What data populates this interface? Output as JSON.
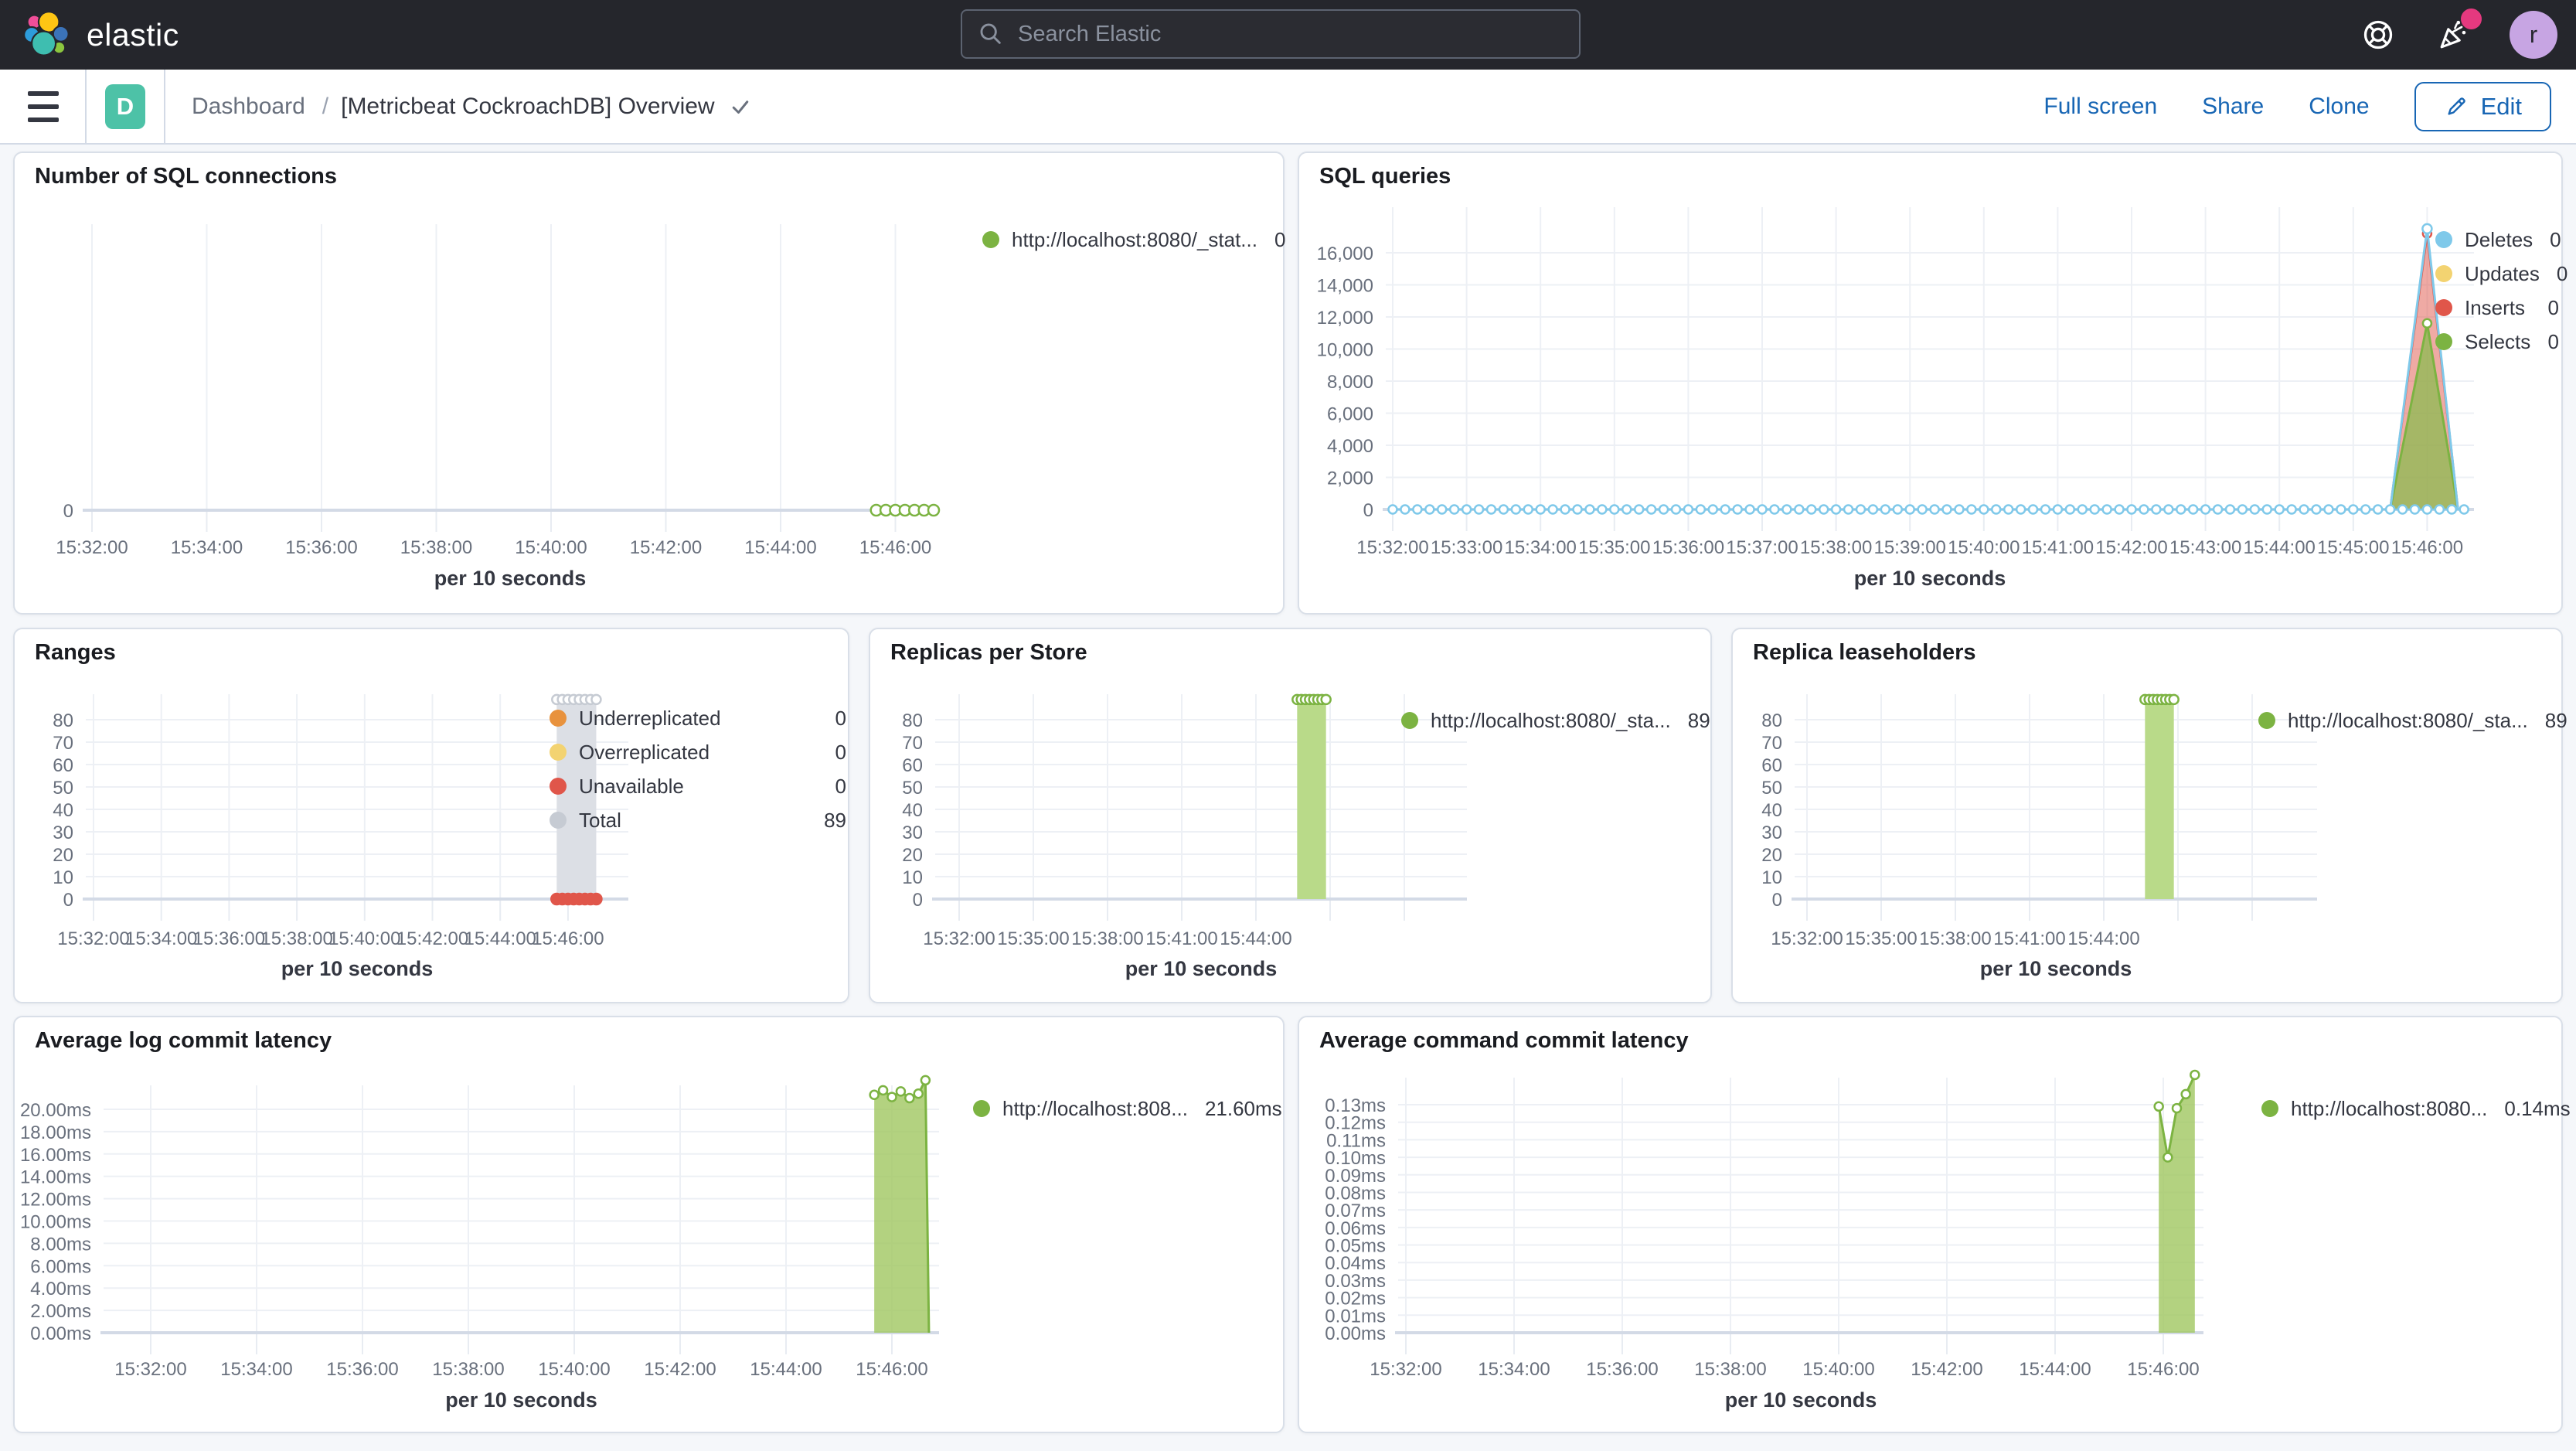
{
  "header": {
    "logo_text": "elastic",
    "search_placeholder": "Search Elastic",
    "avatar_letter": "r",
    "icons": [
      "search-icon",
      "life-buoy-icon",
      "party-popper-icon"
    ]
  },
  "toolbar": {
    "menu_icon": "hamburger-icon",
    "badge_letter": "D",
    "breadcrumb_root": "Dashboard",
    "separator": "/",
    "title": "[Metricbeat CockroachDB] Overview",
    "links": [
      "Full screen",
      "Share",
      "Clone"
    ],
    "edit_label": "Edit"
  },
  "colors": {
    "topbar_bg": "#25262C",
    "accent_blue": "#1866B4",
    "badge_teal": "#4DC2A7",
    "notification_pink": "#E5397F",
    "series_green": "#7CB342",
    "series_blue": "#7FC9EA",
    "series_red": "#E0564A",
    "series_yellow": "#F3D371",
    "series_orange": "#E8923D",
    "series_gray": "#C6CBD3"
  },
  "chart_data": [
    {
      "type": "line",
      "title": "Number of SQL connections",
      "xlabel": "per 10 seconds",
      "x_interval_s": 120,
      "x_ticks": [
        "15:32:00",
        "15:34:00",
        "15:36:00",
        "15:38:00",
        "15:40:00",
        "15:42:00",
        "15:44:00",
        "15:46:00"
      ],
      "y_ticks": [
        {
          "label": "0",
          "v": 0
        }
      ],
      "series": [
        {
          "name": "http://localhost:8080/_stat...",
          "style": "dots",
          "color": "#7CB342",
          "value": 0,
          "from": "15:45:40",
          "to": "15:46:40",
          "interval_s": 10,
          "connect": true
        }
      ],
      "legend": [
        {
          "label": "http://localhost:8080/_stat...",
          "value": "0",
          "color": "#7CB342"
        }
      ]
    },
    {
      "type": "area",
      "title": "SQL queries",
      "xlabel": "per 10 seconds",
      "x_interval_s": 60,
      "x_ticks": [
        "15:32:00",
        "15:33:00",
        "15:34:00",
        "15:35:00",
        "15:36:00",
        "15:37:00",
        "15:38:00",
        "15:39:00",
        "15:40:00",
        "15:41:00",
        "15:42:00",
        "15:43:00",
        "15:44:00",
        "15:45:00",
        "15:46:00"
      ],
      "y_ticks": [
        {
          "label": "16,000",
          "v": 16000
        },
        {
          "label": "14,000",
          "v": 14000
        },
        {
          "label": "12,000",
          "v": 12000
        },
        {
          "label": "10,000",
          "v": 10000
        },
        {
          "label": "8,000",
          "v": 8000
        },
        {
          "label": "6,000",
          "v": 6000
        },
        {
          "label": "4,000",
          "v": 4000
        },
        {
          "label": "2,000",
          "v": 2000
        },
        {
          "label": "0",
          "v": 0
        }
      ],
      "series": [
        {
          "name": "Inserts",
          "style": "area",
          "color": "#E0564A",
          "fill": "rgba(224,86,74,0.5)",
          "points": [
            [
              "15:45:30",
              0
            ],
            [
              "15:46:00",
              17200
            ],
            [
              "15:46:25",
              0
            ]
          ]
        },
        {
          "name": "Selects",
          "style": "area",
          "color": "#7CB342",
          "fill": "rgba(140,187,81,0.75)",
          "points": [
            [
              "15:45:30",
              0
            ],
            [
              "15:46:00",
              11600
            ],
            [
              "15:46:25",
              0
            ]
          ]
        },
        {
          "name": "Deletes",
          "style": "zline",
          "color": "#7FC9EA",
          "value": 0,
          "from": "15:32:00",
          "to": "15:46:30",
          "interval_s": 10,
          "spike": [
            [
              "15:45:30",
              0
            ],
            [
              "15:46:00",
              17500
            ],
            [
              "15:46:25",
              0
            ]
          ]
        },
        {
          "name": "Updates",
          "style": "hidden",
          "color": "#F3D371",
          "value": 0
        }
      ],
      "legend": [
        {
          "label": "Deletes",
          "value": "0",
          "color": "#7FC9EA"
        },
        {
          "label": "Updates",
          "value": "0",
          "color": "#F3D371"
        },
        {
          "label": "Inserts",
          "value": "0",
          "color": "#E0564A"
        },
        {
          "label": "Selects",
          "value": "0",
          "color": "#7CB342"
        }
      ]
    },
    {
      "type": "bar",
      "title": "Ranges",
      "xlabel": "per 10 seconds",
      "x_interval_s": 120,
      "x_ticks": [
        "15:32:00",
        "15:34:00",
        "15:36:00",
        "15:38:00",
        "15:40:00",
        "15:42:00",
        "15:44:00",
        "15:46:00"
      ],
      "y_ticks": [
        {
          "label": "80",
          "v": 80
        },
        {
          "label": "70",
          "v": 70
        },
        {
          "label": "60",
          "v": 60
        },
        {
          "label": "50",
          "v": 50
        },
        {
          "label": "40",
          "v": 40
        },
        {
          "label": "30",
          "v": 30
        },
        {
          "label": "20",
          "v": 20
        },
        {
          "label": "10",
          "v": 10
        },
        {
          "label": "0",
          "v": 0
        }
      ],
      "series": [
        {
          "name": "Total",
          "style": "bar",
          "color": "#DCDFE5",
          "marker_color": "#C6CBD3",
          "value": 89,
          "from": "15:45:40",
          "to": "15:46:50",
          "marker_interval_s": 10
        },
        {
          "name": "Unavailable",
          "style": "dots",
          "color": "#E0564A",
          "filled": true,
          "value": 0,
          "from": "15:45:40",
          "to": "15:46:50",
          "interval_s": 10
        }
      ],
      "legend": [
        {
          "label": "Underreplicated",
          "value": "0",
          "color": "#E8923D"
        },
        {
          "label": "Overreplicated",
          "value": "0",
          "color": "#F3D371"
        },
        {
          "label": "Unavailable",
          "value": "0",
          "color": "#E0564A"
        },
        {
          "label": "Total",
          "value": "89",
          "color": "#C6CBD3"
        }
      ]
    },
    {
      "type": "bar",
      "title": "Replicas per Store",
      "xlabel": "per 10 seconds",
      "x_interval_s": 180,
      "x_ticks": [
        "15:32:00",
        "15:35:00",
        "15:38:00",
        "15:41:00",
        "15:44:00"
      ],
      "y_ticks": [
        {
          "label": "80",
          "v": 80
        },
        {
          "label": "70",
          "v": 70
        },
        {
          "label": "60",
          "v": 60
        },
        {
          "label": "50",
          "v": 50
        },
        {
          "label": "40",
          "v": 40
        },
        {
          "label": "30",
          "v": 30
        },
        {
          "label": "20",
          "v": 20
        },
        {
          "label": "10",
          "v": 10
        },
        {
          "label": "0",
          "v": 0
        }
      ],
      "series": [
        {
          "name": "http://localhost:8080/_sta...",
          "style": "bar",
          "color": "#B9DA89",
          "marker_color": "#7CB342",
          "value": 89,
          "from": "15:45:40",
          "to": "15:46:50",
          "marker_interval_s": 10
        }
      ],
      "legend": [
        {
          "label": "http://localhost:8080/_sta...",
          "value": "89",
          "color": "#7CB342"
        }
      ]
    },
    {
      "type": "bar",
      "title": "Replica leaseholders",
      "xlabel": "per 10 seconds",
      "x_interval_s": 180,
      "x_ticks": [
        "15:32:00",
        "15:35:00",
        "15:38:00",
        "15:41:00",
        "15:44:00"
      ],
      "y_ticks": [
        {
          "label": "80",
          "v": 80
        },
        {
          "label": "70",
          "v": 70
        },
        {
          "label": "60",
          "v": 60
        },
        {
          "label": "50",
          "v": 50
        },
        {
          "label": "40",
          "v": 40
        },
        {
          "label": "30",
          "v": 30
        },
        {
          "label": "20",
          "v": 20
        },
        {
          "label": "10",
          "v": 10
        },
        {
          "label": "0",
          "v": 0
        }
      ],
      "series": [
        {
          "name": "http://localhost:8080/_sta...",
          "style": "bar",
          "color": "#B9DA89",
          "marker_color": "#7CB342",
          "value": 89,
          "from": "15:45:40",
          "to": "15:46:50",
          "marker_interval_s": 10
        }
      ],
      "legend": [
        {
          "label": "http://localhost:8080/_sta...",
          "value": "89",
          "color": "#7CB342"
        }
      ]
    },
    {
      "type": "area",
      "title": "Average log commit latency",
      "xlabel": "per 10 seconds",
      "x_interval_s": 120,
      "x_ticks": [
        "15:32:00",
        "15:34:00",
        "15:36:00",
        "15:38:00",
        "15:40:00",
        "15:42:00",
        "15:44:00",
        "15:46:00"
      ],
      "y_ticks": [
        {
          "label": "20.00ms",
          "v": 20
        },
        {
          "label": "18.00ms",
          "v": 18
        },
        {
          "label": "16.00ms",
          "v": 16
        },
        {
          "label": "14.00ms",
          "v": 14
        },
        {
          "label": "12.00ms",
          "v": 12
        },
        {
          "label": "10.00ms",
          "v": 10
        },
        {
          "label": "8.00ms",
          "v": 8
        },
        {
          "label": "6.00ms",
          "v": 6
        },
        {
          "label": "4.00ms",
          "v": 4
        },
        {
          "label": "2.00ms",
          "v": 2
        },
        {
          "label": "0.00ms",
          "v": 0
        }
      ],
      "series": [
        {
          "name": "http://localhost:808...",
          "style": "area",
          "color": "#7CB342",
          "fill": "rgba(160,199,96,0.8)",
          "points": [
            [
              "15:45:40",
              21.3
            ],
            [
              "15:45:50",
              21.7
            ],
            [
              "15:46:00",
              21.1
            ],
            [
              "15:46:10",
              21.6
            ],
            [
              "15:46:20",
              21.0
            ],
            [
              "15:46:30",
              21.4
            ],
            [
              "15:46:38",
              22.6
            ],
            [
              "15:46:42",
              0
            ]
          ]
        }
      ],
      "legend": [
        {
          "label": "http://localhost:808...",
          "value": "21.60ms",
          "color": "#7CB342"
        }
      ]
    },
    {
      "type": "area",
      "title": "Average command commit latency",
      "xlabel": "per 10 seconds",
      "x_interval_s": 120,
      "x_ticks": [
        "15:32:00",
        "15:34:00",
        "15:36:00",
        "15:38:00",
        "15:40:00",
        "15:42:00",
        "15:44:00",
        "15:46:00"
      ],
      "y_ticks": [
        {
          "label": "0.13ms",
          "v": 0.13
        },
        {
          "label": "0.12ms",
          "v": 0.12
        },
        {
          "label": "0.11ms",
          "v": 0.11
        },
        {
          "label": "0.10ms",
          "v": 0.1
        },
        {
          "label": "0.09ms",
          "v": 0.09
        },
        {
          "label": "0.08ms",
          "v": 0.08
        },
        {
          "label": "0.07ms",
          "v": 0.07
        },
        {
          "label": "0.06ms",
          "v": 0.06
        },
        {
          "label": "0.05ms",
          "v": 0.05
        },
        {
          "label": "0.04ms",
          "v": 0.04
        },
        {
          "label": "0.03ms",
          "v": 0.03
        },
        {
          "label": "0.02ms",
          "v": 0.02
        },
        {
          "label": "0.01ms",
          "v": 0.01
        },
        {
          "label": "0.00ms",
          "v": 0.0
        }
      ],
      "series": [
        {
          "name": "http://localhost:8080...",
          "style": "area",
          "color": "#7CB342",
          "fill": "rgba(160,199,96,0.8)",
          "points": [
            [
              "15:45:55",
              0.129
            ],
            [
              "15:46:05",
              0.1
            ],
            [
              "15:46:15",
              0.128
            ],
            [
              "15:46:25",
              0.136
            ],
            [
              "15:46:35",
              0.147
            ]
          ]
        }
      ],
      "legend": [
        {
          "label": "http://localhost:8080...",
          "value": "0.14ms",
          "color": "#7CB342"
        }
      ]
    }
  ]
}
